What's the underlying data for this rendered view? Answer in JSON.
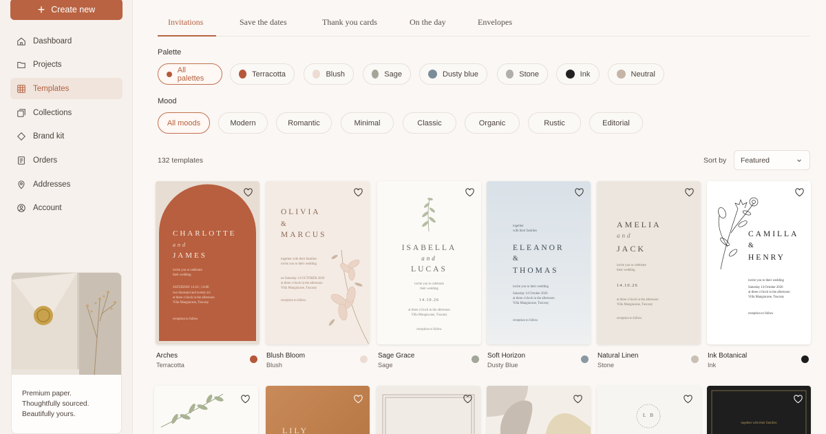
{
  "sidebar": {
    "create_label": "Create new",
    "items": [
      {
        "label": "Dashboard",
        "icon": "home-icon"
      },
      {
        "label": "Projects",
        "icon": "folder-icon"
      },
      {
        "label": "Templates",
        "icon": "grid-icon",
        "active": true
      },
      {
        "label": "Collections",
        "icon": "collections-icon"
      },
      {
        "label": "Brand kit",
        "icon": "diamond-icon"
      },
      {
        "label": "Orders",
        "icon": "receipt-icon"
      },
      {
        "label": "Addresses",
        "icon": "pin-icon"
      },
      {
        "label": "Account",
        "icon": "user-icon"
      }
    ],
    "promo": {
      "line1": "Premium paper.",
      "line2": "Thoughtfully sourced.",
      "line3": "Beautifully yours."
    }
  },
  "tabs": [
    "Invitations",
    "Save the dates",
    "Thank you cards",
    "On the day",
    "Envelopes"
  ],
  "palette": {
    "label": "Palette",
    "chips": [
      {
        "label": "All palettes",
        "color": "#b5583a",
        "active": true
      },
      {
        "label": "Terracotta",
        "color": "#b5583a"
      },
      {
        "label": "Blush",
        "color": "#ecdcd3"
      },
      {
        "label": "Sage",
        "color": "#a3a698"
      },
      {
        "label": "Dusty blue",
        "color": "#7b8c99"
      },
      {
        "label": "Stone",
        "color": "#b2afaa"
      },
      {
        "label": "Ink",
        "color": "#222222"
      },
      {
        "label": "Neutral",
        "color": "#c4b5a6"
      }
    ]
  },
  "mood": {
    "label": "Mood",
    "chips": [
      "All moods",
      "Modern",
      "Romantic",
      "Minimal",
      "Classic",
      "Organic",
      "Rustic",
      "Editorial"
    ]
  },
  "results": {
    "count": "132 templates",
    "sort_label": "Sort by",
    "sort_value": "Featured"
  },
  "templates": [
    {
      "name": "Arches",
      "palette": "Terracotta",
      "swatch": "#b5583a",
      "names": [
        "CHARLOTTE",
        "and",
        "JAMES"
      ],
      "date": "SATURDAY 14.10. | 14:00"
    },
    {
      "name": "Blush Bloom",
      "palette": "Blush",
      "swatch": "#ecdcd3",
      "names": [
        "OLIVIA",
        "&",
        "MARCUS"
      ],
      "date": "14 OCTOBER 2026"
    },
    {
      "name": "Sage Grace",
      "palette": "Sage",
      "swatch": "#a3a698",
      "names": [
        "ISABELLA",
        "and",
        "LUCAS"
      ],
      "date": "14.10.26"
    },
    {
      "name": "Soft Horizon",
      "palette": "Dusty Blue",
      "swatch": "#8a98a3",
      "names": [
        "ELEANOR",
        "&",
        "THOMAS"
      ],
      "date": "14 October 2026"
    },
    {
      "name": "Natural Linen",
      "palette": "Stone",
      "swatch": "#c9c0b4",
      "names": [
        "AMELIA",
        "and",
        "JACK"
      ],
      "date": "14.10.26"
    },
    {
      "name": "Ink Botanical",
      "palette": "Ink",
      "swatch": "#1c1c1c",
      "names": [
        "CAMILLA",
        "&",
        "HENRY"
      ],
      "date": "Saturday 14 October 2026"
    }
  ],
  "second_row": {
    "lily_text": "LILY",
    "ring_initials": "L B",
    "black_card_text": "together with their families"
  },
  "colors": {
    "accent": "#b96342",
    "background": "#faf7f4"
  }
}
